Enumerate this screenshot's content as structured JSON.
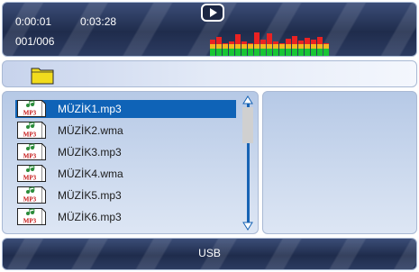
{
  "status": {
    "elapsed": "0:00:01",
    "total": "0:03:28",
    "track_counter": "001/006",
    "play_state_icon": "play-icon"
  },
  "equalizer": {
    "colors": {
      "low": "#19c634",
      "mid": "#f2b81f",
      "high": "#ea2222"
    },
    "bar_levels": [
      0.62,
      0.72,
      0.45,
      0.58,
      0.82,
      0.55,
      0.4,
      0.9,
      0.62,
      0.85,
      0.55,
      0.5,
      0.66,
      0.78,
      0.6,
      0.7,
      0.62,
      0.72,
      0.48
    ]
  },
  "folder_bar": {
    "icon": "folder-icon"
  },
  "playlist": {
    "file_icon_text": "MP3",
    "selected_index": 0,
    "items": [
      {
        "name": "MÜZİK1.mp3"
      },
      {
        "name": "MÜZİK2.wma"
      },
      {
        "name": "MÜZİK3.mp3"
      },
      {
        "name": "MÜZİK4.wma"
      },
      {
        "name": "MÜZİK5.mp3"
      },
      {
        "name": "MÜZİK6.mp3"
      }
    ]
  },
  "source": {
    "label": "USB"
  },
  "colors": {
    "accent": "#0f63b7",
    "panel_dark": "#1f2c4c"
  }
}
